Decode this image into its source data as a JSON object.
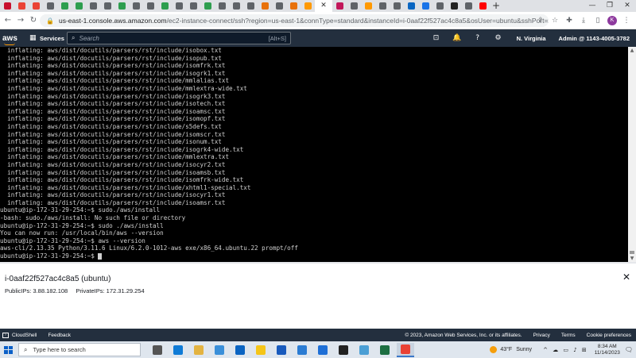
{
  "browser": {
    "tabs": [
      {
        "color": "#c8102e"
      },
      {
        "color": "#ea4335"
      },
      {
        "color": "#ea4335"
      },
      {
        "color": "#5f6368"
      },
      {
        "color": "#2e9e4f"
      },
      {
        "color": "#2e9e4f"
      },
      {
        "color": "#5f6368"
      },
      {
        "color": "#5f6368"
      },
      {
        "color": "#2e9e4f"
      },
      {
        "color": "#5f6368"
      },
      {
        "color": "#5f6368"
      },
      {
        "color": "#2e9e4f"
      },
      {
        "color": "#5f6368"
      },
      {
        "color": "#5f6368"
      },
      {
        "color": "#2e9e4f"
      },
      {
        "color": "#5f6368"
      },
      {
        "color": "#5f6368"
      },
      {
        "color": "#5f6368"
      },
      {
        "color": "#e8710a"
      },
      {
        "color": "#5f6368"
      },
      {
        "color": "#e8710a"
      },
      {
        "color": "#ff9900"
      },
      {
        "color": "#c2185b"
      },
      {
        "color": "#5f6368"
      },
      {
        "color": "#ff9900"
      },
      {
        "color": "#5f6368"
      },
      {
        "color": "#5f6368"
      },
      {
        "color": "#0a66c2"
      },
      {
        "color": "#1a73e8"
      },
      {
        "color": "#5f6368"
      },
      {
        "color": "#222222"
      },
      {
        "color": "#5f6368"
      },
      {
        "color": "#ff0000"
      }
    ],
    "active_tab_close": "✕",
    "new_tab": "+",
    "url_host": "us-east-1.console.aws.amazon.com",
    "url_rest": "/ec2-instance-connect/ssh?region=us-east-1&connType=standard&instanceId=i-0aaf22f527ac4c8a5&osUser=ubuntu&sshPort=22#/",
    "profile_initial": "K"
  },
  "aws_nav": {
    "logo": "aws",
    "services": "Services",
    "search_placeholder": "Search",
    "search_shortcut": "[Alt+S]",
    "region": "N. Virginia",
    "account": "Admin @ 1143-4005-3782"
  },
  "terminal": {
    "lines": [
      "  inflating: aws/dist/docutils/parsers/rst/include/isobox.txt",
      "  inflating: aws/dist/docutils/parsers/rst/include/isopub.txt",
      "  inflating: aws/dist/docutils/parsers/rst/include/isomfrk.txt",
      "  inflating: aws/dist/docutils/parsers/rst/include/isogrk1.txt",
      "  inflating: aws/dist/docutils/parsers/rst/include/mmlalias.txt",
      "  inflating: aws/dist/docutils/parsers/rst/include/mmlextra-wide.txt",
      "  inflating: aws/dist/docutils/parsers/rst/include/isogrk3.txt",
      "  inflating: aws/dist/docutils/parsers/rst/include/isotech.txt",
      "  inflating: aws/dist/docutils/parsers/rst/include/isoamsc.txt",
      "  inflating: aws/dist/docutils/parsers/rst/include/isomopf.txt",
      "  inflating: aws/dist/docutils/parsers/rst/include/s5defs.txt",
      "  inflating: aws/dist/docutils/parsers/rst/include/isomscr.txt",
      "  inflating: aws/dist/docutils/parsers/rst/include/isonum.txt",
      "  inflating: aws/dist/docutils/parsers/rst/include/isogrk4-wide.txt",
      "  inflating: aws/dist/docutils/parsers/rst/include/mmlextra.txt",
      "  inflating: aws/dist/docutils/parsers/rst/include/isocyr2.txt",
      "  inflating: aws/dist/docutils/parsers/rst/include/isoamsb.txt",
      "  inflating: aws/dist/docutils/parsers/rst/include/isomfrk-wide.txt",
      "  inflating: aws/dist/docutils/parsers/rst/include/xhtml1-special.txt",
      "  inflating: aws/dist/docutils/parsers/rst/include/isocyr1.txt",
      "  inflating: aws/dist/docutils/parsers/rst/include/isoamsr.txt",
      "ubuntu@ip-172-31-29-254:~$ sudo./aws/install",
      "-bash: sudo./aws/install: No such file or directory",
      "ubuntu@ip-172-31-29-254:~$ sudo ./aws/install",
      "You can now run: /usr/local/bin/aws --version",
      "ubuntu@ip-172-31-29-254:~$ aws --version",
      "aws-cli/2.13.35 Python/3.11.6 Linux/6.2.0-1012-aws exe/x86_64.ubuntu.22 prompt/off",
      "ubuntu@ip-172-31-29-254:~$ "
    ]
  },
  "instance": {
    "title": "i-0aaf22f527ac4c8a5 (ubuntu)",
    "public_ips": "PublicIPs: 3.88.182.108",
    "private_ips": "PrivateIPs: 172.31.29.254"
  },
  "footer": {
    "cloudshell": "CloudShell",
    "feedback": "Feedback",
    "copyright": "© 2023, Amazon Web Services, Inc. or its affiliates.",
    "privacy": "Privacy",
    "terms": "Terms",
    "cookies": "Cookie preferences"
  },
  "taskbar": {
    "search_placeholder": "Type here to search",
    "apps": [
      {
        "color": "#555555"
      },
      {
        "color": "#0f7bd6"
      },
      {
        "color": "#e3b341"
      },
      {
        "color": "#3a8fd9"
      },
      {
        "color": "#0a64c2"
      },
      {
        "color": "#f5c518"
      },
      {
        "color": "#185abd"
      },
      {
        "color": "#2b7cd3"
      },
      {
        "color": "#1e6fd6"
      },
      {
        "color": "#222222"
      },
      {
        "color": "#4b9fd5"
      },
      {
        "color": "#1d6f42"
      },
      {
        "color": "#e94235"
      }
    ],
    "weather_temp": "43°F",
    "weather_desc": "Sunny",
    "time": "8:34 AM",
    "date": "11/14/2023"
  }
}
